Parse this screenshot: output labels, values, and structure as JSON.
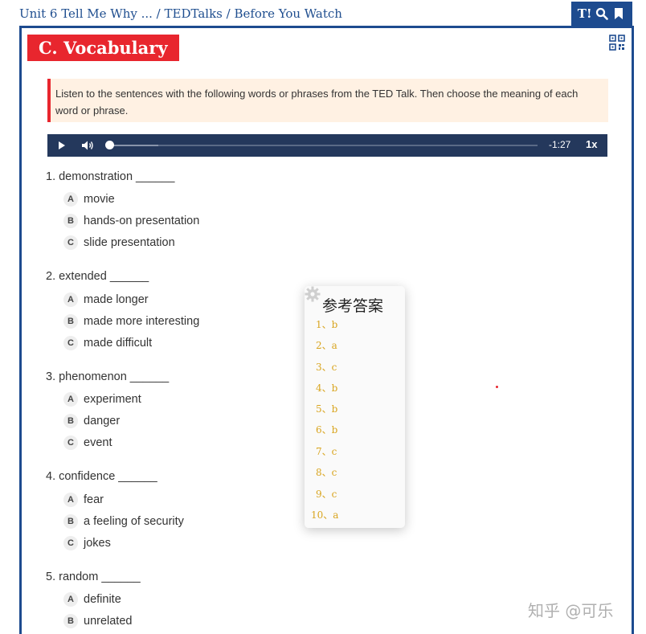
{
  "header": {
    "breadcrumb": "Unit 6 Tell Me Why ... / TEDTalks / Before You Watch",
    "tools": {
      "text_size_label": "T!",
      "icons": [
        "search-icon",
        "bookmark-icon"
      ]
    }
  },
  "section": {
    "title": "C. Vocabulary",
    "instructions": "Listen to the sentences with the following words or phrases from the TED Talk. Then choose the meaning of each word or phrase."
  },
  "audio": {
    "time_remaining": "-1:27",
    "speed": "1x",
    "progress": 0.0,
    "buffered": 0.12
  },
  "questions": [
    {
      "label": "1.  demonstration ______",
      "options": [
        {
          "letter": "A",
          "text": "movie"
        },
        {
          "letter": "B",
          "text": "hands-on presentation"
        },
        {
          "letter": "C",
          "text": "slide presentation"
        }
      ]
    },
    {
      "label": "2.  extended ______",
      "options": [
        {
          "letter": "A",
          "text": "made longer"
        },
        {
          "letter": "B",
          "text": "made more interesting"
        },
        {
          "letter": "C",
          "text": "made difficult"
        }
      ]
    },
    {
      "label": "3.  phenomenon ______",
      "options": [
        {
          "letter": "A",
          "text": "experiment"
        },
        {
          "letter": "B",
          "text": "danger"
        },
        {
          "letter": "C",
          "text": "event"
        }
      ]
    },
    {
      "label": "4.  confidence ______",
      "options": [
        {
          "letter": "A",
          "text": "fear"
        },
        {
          "letter": "B",
          "text": "a feeling of security"
        },
        {
          "letter": "C",
          "text": "jokes"
        }
      ]
    },
    {
      "label": "5.  random ______",
      "options": [
        {
          "letter": "A",
          "text": "definite"
        },
        {
          "letter": "B",
          "text": "unrelated"
        }
      ]
    }
  ],
  "answer_popup": {
    "title": "参考答案",
    "answers": [
      "1、b",
      "2、a",
      "3、c",
      "4、b",
      "5、b",
      "6、b",
      "7、c",
      "8、c",
      "9、c",
      "10、a"
    ]
  },
  "watermark": "知乎 @可乐",
  "colors": {
    "brand_blue": "#1d4b8f",
    "accent_red": "#e8262e",
    "answer_gold": "#d9a520",
    "player_bg": "#24385c"
  }
}
